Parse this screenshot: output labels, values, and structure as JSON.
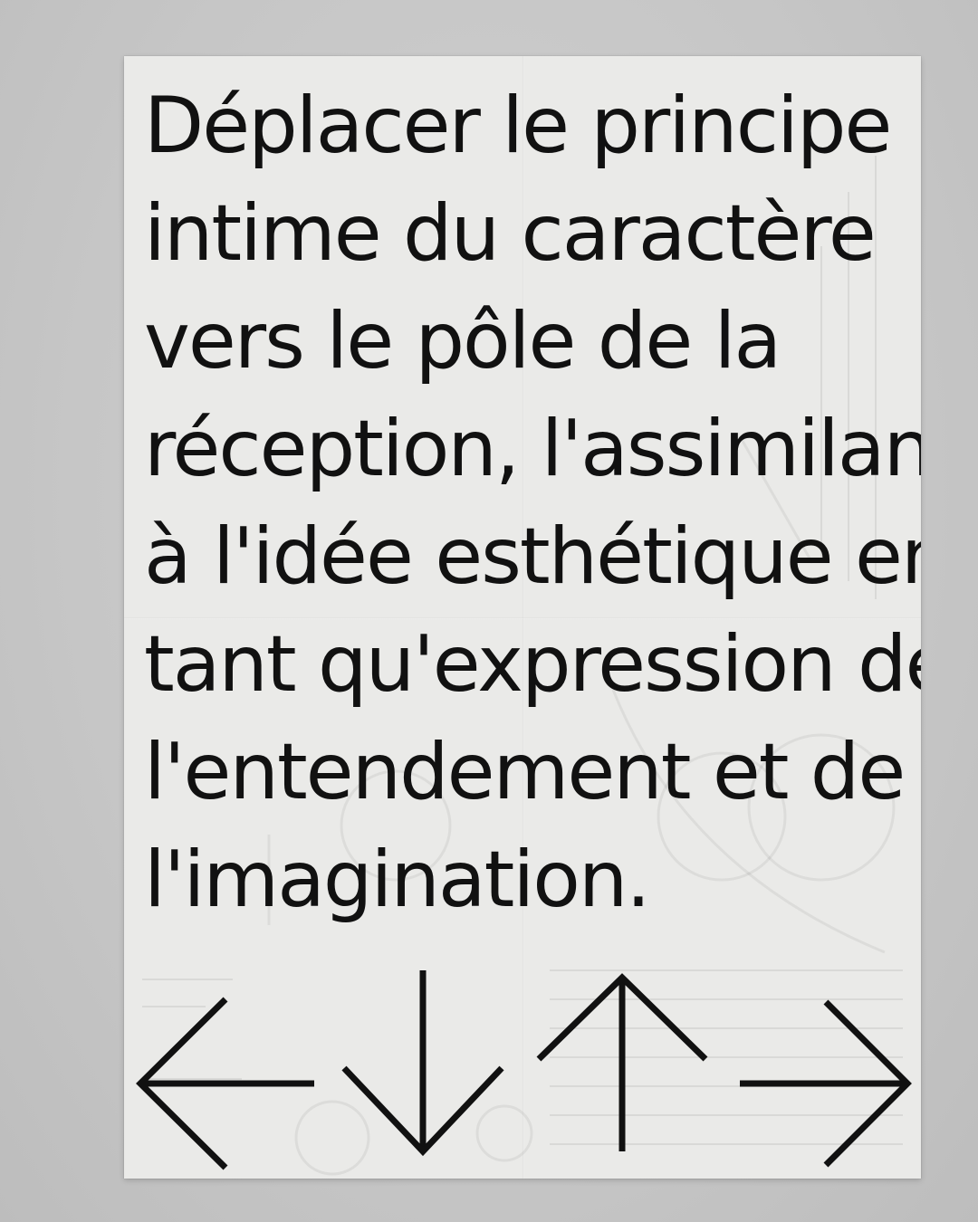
{
  "poster": {
    "paper_color": "#eaeae8",
    "ink_color": "#111111",
    "text_lines": [
      "Déplacer le principe",
      "intime du caractère",
      "vers le pôle de la",
      "réception, l'assimilant",
      "à l'idée esthétique en",
      "tant qu'expression de",
      "l'entendement et de",
      "l'imagination."
    ],
    "arrows": [
      "left-arrow-icon",
      "down-arrow-icon",
      "up-arrow-icon",
      "right-arrow-icon"
    ]
  }
}
